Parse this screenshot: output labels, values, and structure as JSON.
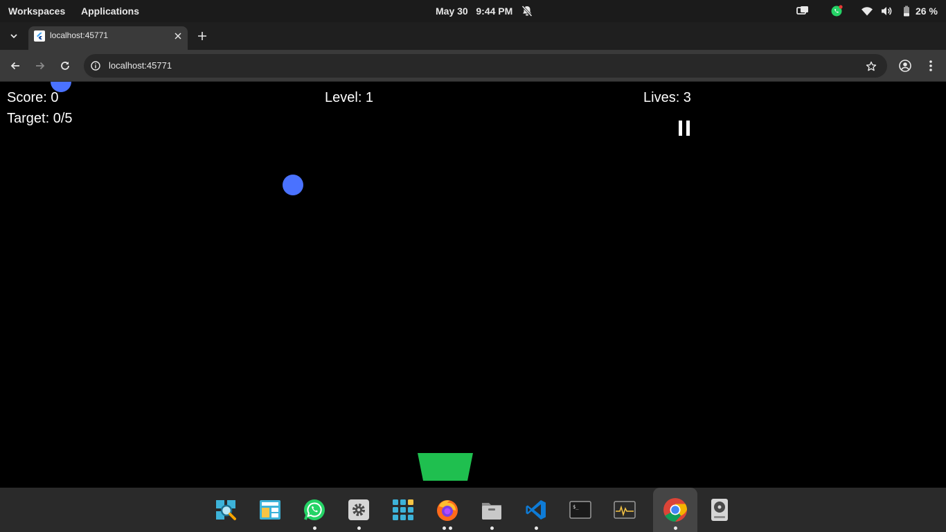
{
  "system_bar": {
    "workspaces": "Workspaces",
    "applications": "Applications",
    "clock": "May 30   9:44 PM",
    "battery": "26 %",
    "icons": [
      "bell-muted-icon",
      "screen-share-icon",
      "whatsapp-tray-icon",
      "wifi-icon",
      "volume-icon",
      "battery-icon"
    ]
  },
  "browser": {
    "tab_title": "localhost:45771",
    "url": "localhost:45771",
    "colors": {
      "tab_active": "#3a3a3a",
      "toolbar": "#3a3a3a",
      "omnibox": "#282828"
    }
  },
  "game": {
    "score_text": "Score: 0",
    "target_text": "Target: 0/5",
    "level_text": "Level: 1",
    "lives_text": "Lives: 3",
    "colors": {
      "ball": "#4a72ff",
      "basket": "#1fbf4f",
      "background": "#000000"
    }
  },
  "dock": {
    "apps": [
      {
        "name": "magnifier-app",
        "running": false
      },
      {
        "name": "screenshot-app",
        "running": false
      },
      {
        "name": "whatsapp-app",
        "running": true
      },
      {
        "name": "settings-app",
        "running": true
      },
      {
        "name": "app-grid",
        "running": false
      },
      {
        "name": "firefox-app",
        "running": true
      },
      {
        "name": "files-app",
        "running": true
      },
      {
        "name": "vscode-app",
        "running": true
      },
      {
        "name": "terminal-app",
        "running": false
      },
      {
        "name": "system-monitor-app",
        "running": false
      },
      {
        "name": "chrome-app",
        "running": true
      },
      {
        "name": "disk-app",
        "running": false
      }
    ]
  }
}
